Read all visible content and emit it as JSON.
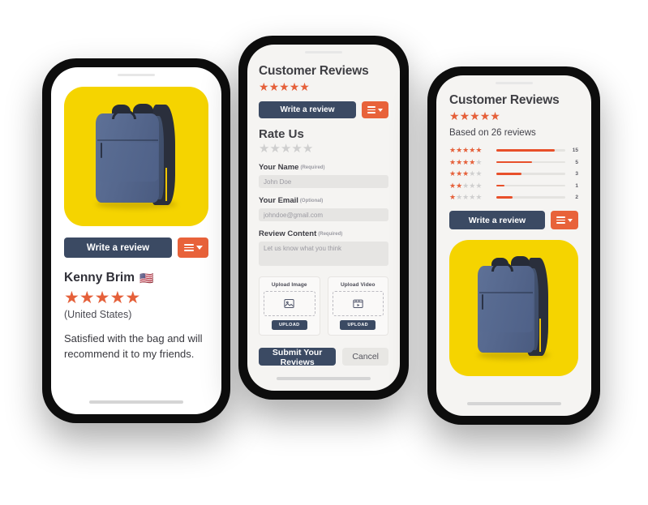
{
  "phone_left": {
    "product_image_alt": "blue-backpack-on-yellow",
    "write_review_label": "Write a review",
    "menu_icon": "hamburger-chevron-icon",
    "reviewer_name": "Kenny Brim",
    "reviewer_flag": "🇺🇸",
    "reviewer_stars_filled": 5,
    "reviewer_stars_total": 5,
    "reviewer_country": "(United States)",
    "review_text": "Satisfied with the bag and will recommend it to my friends."
  },
  "phone_mid": {
    "title": "Customer Reviews",
    "header_stars_filled": 5,
    "header_stars_total": 5,
    "write_review_label": "Write a review",
    "menu_icon": "hamburger-chevron-icon",
    "rate_us_label": "Rate Us",
    "rate_stars_filled": 0,
    "rate_stars_total": 5,
    "fields": [
      {
        "label": "Your Name",
        "requirement": "(Required)",
        "placeholder": "John Doe",
        "value": ""
      },
      {
        "label": "Your Email",
        "requirement": "(Optional)",
        "placeholder": "johndoe@gmail.com",
        "value": ""
      },
      {
        "label": "Review Content",
        "requirement": "(Required)",
        "placeholder": "Let us know what you think",
        "value": ""
      }
    ],
    "uploads": [
      {
        "title": "Upload Image",
        "icon": "image-icon",
        "button_label": "UPLOAD"
      },
      {
        "title": "Upload Video",
        "icon": "video-icon",
        "button_label": "UPLOAD"
      }
    ],
    "submit_label": "Submit Your Reviews",
    "cancel_label": "Cancel"
  },
  "phone_right": {
    "title": "Customer Reviews",
    "header_stars_filled": 5,
    "header_stars_total": 5,
    "based_on": "Based on 26 reviews",
    "breakdown": [
      {
        "stars": 5,
        "count": "15",
        "percent": 85
      },
      {
        "stars": 4,
        "count": "5",
        "percent": 52
      },
      {
        "stars": 3,
        "count": "3",
        "percent": 36
      },
      {
        "stars": 2,
        "count": "1",
        "percent": 12
      },
      {
        "stars": 1,
        "count": "2",
        "percent": 24
      }
    ],
    "write_review_label": "Write a review",
    "menu_icon": "hamburger-chevron-icon",
    "product_image_alt": "blue-backpack-on-yellow"
  },
  "colors": {
    "accent_orange": "#e8623a",
    "star_orange": "#e5603a",
    "bar_orange": "#e8502a",
    "navy": "#3b4a63",
    "yellow": "#f5d400",
    "screen_bg": "#f5f4f2",
    "star_off": "#cfcfcf"
  }
}
